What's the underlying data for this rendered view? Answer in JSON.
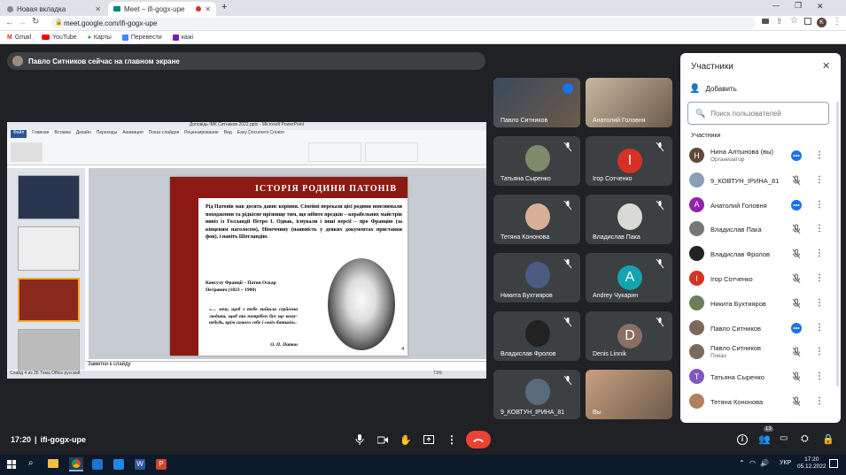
{
  "browser": {
    "tabs": [
      {
        "label": "Новая вкладка",
        "active": false
      },
      {
        "label": "Meet – ifi-gogx-upe",
        "active": true
      }
    ],
    "url": "meet.google.com/ifi-gogx-upe",
    "profile_initial": "K",
    "bookmarks": [
      "Gmail",
      "YouTube",
      "Карты",
      "Перевести",
      "кажі"
    ]
  },
  "banner": {
    "text": "Павло Ситников сейчас на главном экране"
  },
  "presentation": {
    "window_title": "Доповідь ІМК Ситников 2022.pptx - Microsoft PowerPoint",
    "ribbon_tabs": [
      "Файл",
      "Главная",
      "Вставка",
      "Дизайн",
      "Переходы",
      "Анимация",
      "Показ слайдов",
      "Рецензирование",
      "Вид",
      "Easy Document Creator"
    ],
    "slide": {
      "title": "ІСТОРІЯ РОДИНИ ПАТОНІВ",
      "body": "Рід Патонів мав досить давнє коріння. Сімейні перекази цієї родини пояснювали походження та рідкісне прізвище тим, що нібито предків – корабельних майстрів вивіз із Голландії Петро І. Однак, існували і інші версії – про Францію (за кінцевим наголосом), Німеччину (наявність у деяких документах приставки фон), і навіть Шотландію.",
      "caption": "Консулу Франції – Патон Оскар Петрович (1823 – 1900)",
      "quote": "«… хочу, щоб з тебе вийшла серйозна людина, щоб ти потрібен був ще кому-небудь, крім самого себе і своїх батьків».",
      "signature": "О. П. Патон",
      "page_number": "4"
    },
    "notes_placeholder": "Заметки к слайду",
    "status": "Слайд 4 из 36   Тема Office   русский",
    "zoom": "71%"
  },
  "tiles": [
    {
      "name": "Павло Ситников",
      "avatar": "",
      "color": "",
      "speaking": true
    },
    {
      "name": "Анатолий Головня",
      "avatar": "",
      "color": "",
      "speaking": false
    },
    {
      "name": "Татьяна Сыренко",
      "avatar": "",
      "color": "",
      "speaking": false
    },
    {
      "name": "Ігор Сотченко",
      "avatar": "I",
      "color": "#d93025",
      "speaking": false
    },
    {
      "name": "Тетяна Кононова",
      "avatar": "",
      "color": "",
      "speaking": false
    },
    {
      "name": "Владислав Пака",
      "avatar": "",
      "color": "",
      "speaking": false
    },
    {
      "name": "Никита Бухтияров",
      "avatar": "",
      "color": "",
      "speaking": false
    },
    {
      "name": "Andrey Чукарин",
      "avatar": "A",
      "color": "#12a4af",
      "speaking": false
    },
    {
      "name": "Владислав Фролов",
      "avatar": "",
      "color": "",
      "speaking": false
    },
    {
      "name": "Denis Linnik",
      "avatar": "D",
      "color": "#8d6e63",
      "speaking": false
    },
    {
      "name": "9_КОВТУН_ІРИНА_81",
      "avatar": "",
      "color": "",
      "speaking": false
    },
    {
      "name": "Вы",
      "avatar": "",
      "color": "",
      "speaking": false
    }
  ],
  "meeting": {
    "time": "17:20",
    "code": "ifi-gogx-upe",
    "participant_count": "13"
  },
  "panel": {
    "title": "Участники",
    "add_label": "Добавить",
    "search_placeholder": "Поиск пользователей",
    "section_label": "Участники",
    "people": [
      {
        "name": "Нина Алтынова (вы)",
        "sub": "Организатор",
        "initial": "Н",
        "color": "#5f4b3b",
        "mic": "active"
      },
      {
        "name": "9_КОВТУН_ІРИНА_81",
        "sub": "",
        "initial": "",
        "color": "#8aa0b8",
        "mic": "muted"
      },
      {
        "name": "Анатолий Головня",
        "sub": "",
        "initial": "А",
        "color": "#8e24aa",
        "mic": "active"
      },
      {
        "name": "Владислав Пака",
        "sub": "",
        "initial": "",
        "color": "#777",
        "mic": "muted"
      },
      {
        "name": "Владислав Фролов",
        "sub": "",
        "initial": "",
        "color": "#222",
        "mic": "muted"
      },
      {
        "name": "Ігор Сотченко",
        "sub": "",
        "initial": "I",
        "color": "#d93025",
        "mic": "muted"
      },
      {
        "name": "Никита Бухтияров",
        "sub": "",
        "initial": "",
        "color": "#6b7f5a",
        "mic": "muted"
      },
      {
        "name": "Павло Ситников",
        "sub": "",
        "initial": "",
        "color": "#7a6a5a",
        "mic": "active"
      },
      {
        "name": "Павло Ситников",
        "sub": "Показ",
        "initial": "",
        "color": "#7a6a5a",
        "mic": "muted"
      },
      {
        "name": "Татьяна Сыренко",
        "sub": "",
        "initial": "Т",
        "color": "#7e57c2",
        "mic": "muted"
      },
      {
        "name": "Тетяна Кононова",
        "sub": "",
        "initial": "",
        "color": "#b08060",
        "mic": "muted"
      }
    ]
  },
  "taskbar": {
    "time": "17:20",
    "date": "05.12.2022",
    "lang": "УКР"
  }
}
